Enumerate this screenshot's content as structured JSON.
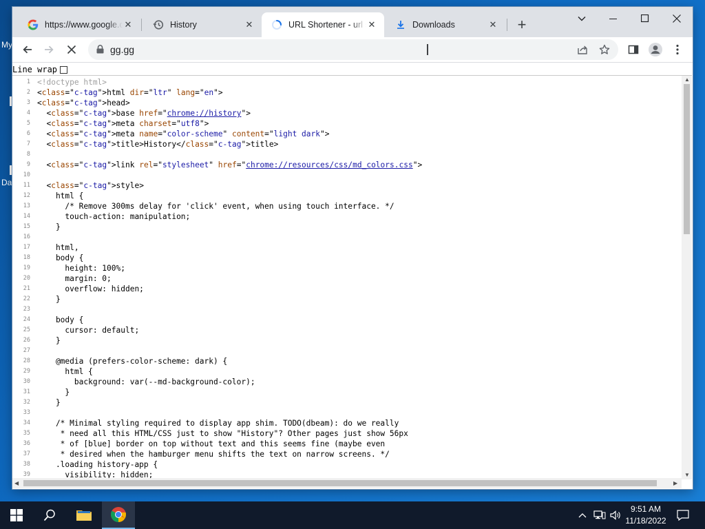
{
  "desktop": {
    "fragments": [
      "My",
      "Da"
    ]
  },
  "tabs": [
    {
      "title": "https://www.google.com",
      "icon": "google-g-icon",
      "active": false
    },
    {
      "title": "History",
      "icon": "history-icon",
      "active": false
    },
    {
      "title": "URL Shortener - url shortener",
      "icon": "loading-spinner-icon",
      "active": true
    },
    {
      "title": "Downloads",
      "icon": "download-icon",
      "active": false
    }
  ],
  "toolbar": {
    "url": "gg.gg"
  },
  "viewer": {
    "line_wrap_label": "Line wrap",
    "line_wrap_checked": false
  },
  "source_lines": [
    "<!doctype html>",
    "<html dir=\"ltr\" lang=\"en\">",
    "<head>",
    "  <base href=\"chrome://history\">",
    "  <meta charset=\"utf8\">",
    "  <meta name=\"color-scheme\" content=\"light dark\">",
    "  <title>History</title>",
    "",
    "  <link rel=\"stylesheet\" href=\"chrome://resources/css/md_colors.css\">",
    "",
    "  <style>",
    "    html {",
    "      /* Remove 300ms delay for 'click' event, when using touch interface. */",
    "      touch-action: manipulation;",
    "    }",
    "",
    "    html,",
    "    body {",
    "      height: 100%;",
    "      margin: 0;",
    "      overflow: hidden;",
    "    }",
    "",
    "    body {",
    "      cursor: default;",
    "    }",
    "",
    "    @media (prefers-color-scheme: dark) {",
    "      html {",
    "        background: var(--md-background-color);",
    "      }",
    "    }",
    "",
    "    /* Minimal styling required to display app shim. TODO(dbeam): do we really",
    "     * need all this HTML/CSS just to show \"History\"? Other pages just show 56px",
    "     * of [blue] border on top without text and this seems fine (maybe even",
    "     * desired when the hamburger menu shifts the text on narrow screens. */",
    "    .loading history-app {",
    "      visibility: hidden;"
  ],
  "taskbar": {
    "time": "9:51 AM",
    "date": "11/18/2022"
  }
}
